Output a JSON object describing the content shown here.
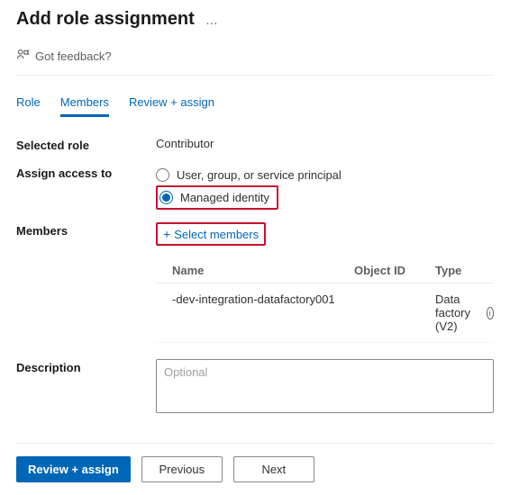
{
  "header": {
    "title": "Add role assignment",
    "more": "…",
    "feedback": "Got feedback?"
  },
  "tabs": {
    "role": "Role",
    "members": "Members",
    "review": "Review + assign"
  },
  "form": {
    "selected_role_label": "Selected role",
    "selected_role_value": "Contributor",
    "assign_access_label": "Assign access to",
    "radio_user": "User, group, or service principal",
    "radio_managed": "Managed identity",
    "members_label": "Members",
    "select_members": "Select members",
    "description_label": "Description",
    "description_placeholder": "Optional"
  },
  "table": {
    "headers": {
      "name": "Name",
      "object_id": "Object ID",
      "type": "Type"
    },
    "rows": [
      {
        "name": "-dev-integration-datafactory001",
        "object_id": "",
        "type": "Data factory (V2)"
      }
    ]
  },
  "footer": {
    "review": "Review + assign",
    "previous": "Previous",
    "next": "Next"
  }
}
